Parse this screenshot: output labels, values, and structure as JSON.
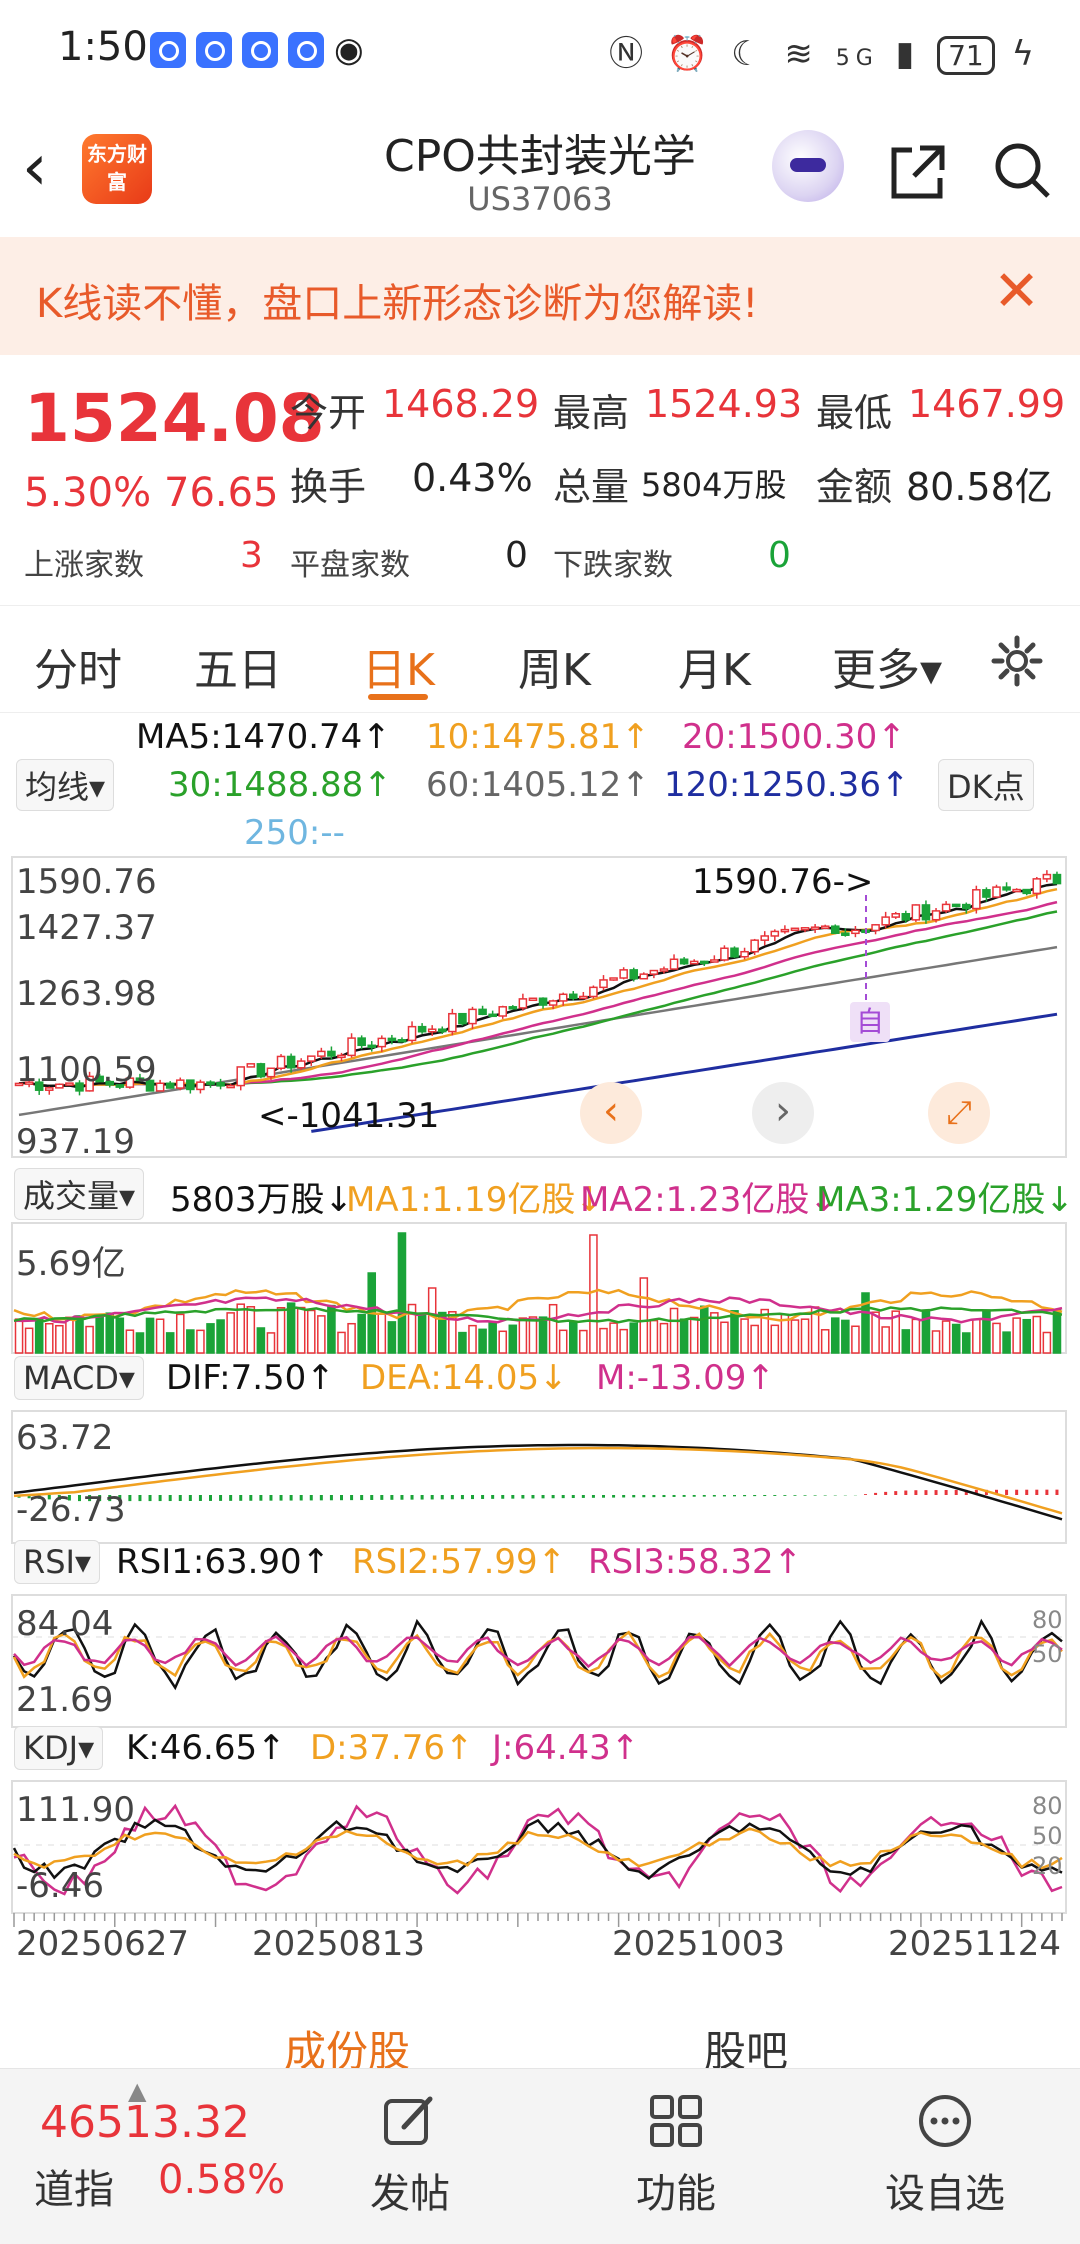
{
  "status": {
    "time": "1:50",
    "signal": "5G",
    "battery": "71"
  },
  "header": {
    "title": "CPO共封装光学",
    "code": "US37063",
    "logo_text": "东方财富"
  },
  "banner": {
    "text": "K线读不懂，盘口上新形态诊断为您解读!"
  },
  "quote": {
    "price": "1524.08",
    "pct": "5.30%",
    "change": "76.65",
    "open_label": "今开",
    "open": "1468.29",
    "high_label": "最高",
    "high": "1524.93",
    "low_label": "最低",
    "low": "1467.99",
    "turnover_label": "换手",
    "turnover": "0.43%",
    "volume_label": "总量",
    "volume": "5804万股",
    "amount_label": "金额",
    "amount": "80.58亿",
    "up_label": "上涨家数",
    "up": "3",
    "flat_label": "平盘家数",
    "flat": "0",
    "down_label": "下跌家数",
    "down": "0"
  },
  "tabs": [
    "分时",
    "五日",
    "日K",
    "周K",
    "月K",
    "更多▾"
  ],
  "active_tab": "日K",
  "ma": {
    "selector": "均线▾",
    "ma5": "MA5:1470.74↑",
    "ma10": "10:1475.81↑",
    "ma20": "20:1500.30↑",
    "ma30": "30:1488.88↑",
    "ma60": "60:1405.12↑",
    "ma120": "120:1250.36↑",
    "ma250": "250:--",
    "dk": "DK点"
  },
  "kline": {
    "y_labels": [
      "1590.76",
      "1427.37",
      "1263.98",
      "1100.59",
      "937.19"
    ],
    "high_marker": "1590.76->",
    "low_marker": "<-1041.31",
    "self_marker": "自"
  },
  "volume_ind": {
    "selector": "成交量▾",
    "v": "5803万股↓",
    "ma1": "MA1:1.19亿股↓",
    "ma2": "MA2:1.23亿股↓",
    "ma3": "MA3:1.29亿股↓",
    "y_top": "5.69亿"
  },
  "macd": {
    "selector": "MACD▾",
    "dif": "DIF:7.50↑",
    "dea": "DEA:14.05↓",
    "m": "M:-13.09↑",
    "y_top": "63.72",
    "y_bottom": "-26.73"
  },
  "rsi": {
    "selector": "RSI▾",
    "rsi1": "RSI1:63.90↑",
    "rsi2": "RSI2:57.99↑",
    "rsi3": "RSI3:58.32↑",
    "y_top": "84.04",
    "y_bottom": "21.69",
    "r80": "80",
    "r50": "50"
  },
  "kdj": {
    "selector": "KDJ▾",
    "k": "K:46.65↑",
    "d": "D:37.76↑",
    "j": "J:64.43↑",
    "y_top": "111.90",
    "y_bottom": "-6.46",
    "r80": "80",
    "r50": "50",
    "r20": "20"
  },
  "dates": [
    "20250627",
    "20250813",
    "20251003",
    "20251124"
  ],
  "segments": [
    "成份股",
    "股吧"
  ],
  "bottom": {
    "index_value": "46513.32",
    "index_name": "道指",
    "index_pct": "0.58%",
    "post": "发帖",
    "func": "功能",
    "watch": "设自选"
  },
  "colors": {
    "up": "#e8343a",
    "down": "#1aa338",
    "accent": "#e8711a",
    "ma5": "#111111",
    "ma10": "#f0a020",
    "ma20": "#d0308c",
    "ma30": "#2aa12a",
    "ma60": "#777777",
    "ma120": "#1f2ea0"
  }
}
